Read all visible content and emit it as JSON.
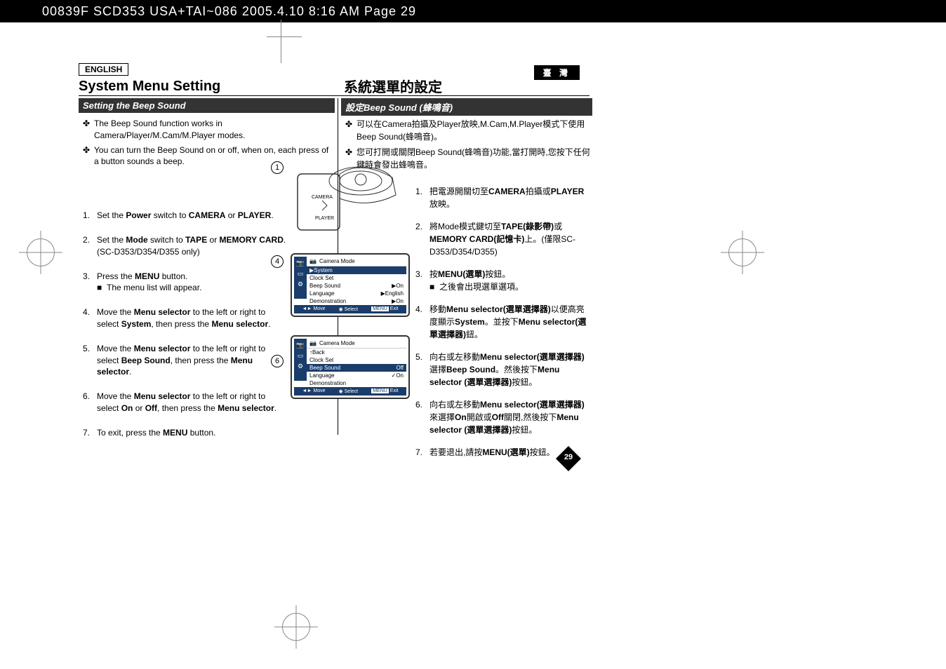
{
  "header": "00839F SCD353 USA+TAI~086  2005.4.10  8:16 AM  Page 29",
  "lang_en": "ENGLISH",
  "lang_tw": "臺 灣",
  "title_en": "System Menu Setting",
  "title_tw": "系統選單的設定",
  "subtitle_en": "Setting the Beep Sound",
  "subtitle_tw": "設定Beep Sound (蜂鳴音)",
  "en_bullets": [
    "The Beep Sound function works in Camera/Player/M.Cam/M.Player modes.",
    "You can turn the Beep Sound on or off, when on, each press of a button sounds a beep."
  ],
  "tw_bullets": [
    "可以在Camera拍攝及Player放映,M.Cam,M.Player模式下使用 Beep Sound(蜂鳴音)。",
    "您可打開或關閉Beep Sound(蜂鳴音)功能,當打開時,您按下任何鍵時會發出蜂鳴音。"
  ],
  "en_steps": [
    {
      "n": "1.",
      "t": "Set the <b>Power</b> switch to <b>CAMERA</b> or <b>PLAYER</b>."
    },
    {
      "n": "2.",
      "t": "Set the <b>Mode</b> switch to <b>TAPE</b> or <b>MEMORY CARD</b>. (SC-D353/D354/D355 only)"
    },
    {
      "n": "3.",
      "t": "Press the <b>MENU</b> button.<div class='sub-bullet'><span class='sq'>■</span><span>The menu list will appear.</span></div>"
    },
    {
      "n": "4.",
      "t": "Move the <b>Menu selector</b> to the left or right to select <b>System</b>, then press the <b>Menu selector</b>."
    },
    {
      "n": "5.",
      "t": "Move the <b>Menu selector</b> to the left or right to select <b>Beep Sound</b>, then press the <b>Menu selector</b>."
    },
    {
      "n": "6.",
      "t": "Move the <b>Menu selector</b> to the left or right to select <b>On</b> or <b>Off</b>, then press the <b>Menu selector</b>."
    },
    {
      "n": "7.",
      "t": "To exit, press the <b>MENU</b> button."
    }
  ],
  "tw_steps": [
    {
      "n": "1.",
      "t": "把電源開關切至<b>CAMERA</b>拍攝或<b>PLAYER</b>放映。"
    },
    {
      "n": "2.",
      "t": "將Mode模式鍵切至<b>TAPE(錄影帶)</b>或<b>MEMORY CARD(記憶卡)</b>上。(僅限SC-D353/D354/D355)"
    },
    {
      "n": "3.",
      "t": "按<b>MENU(選單)</b>按鈕。<div class='sub-bullet'><span class='sq'>■</span><span>之後會出現選單選項。</span></div>"
    },
    {
      "n": "4.",
      "t": "移動<b>Menu selector(選單選擇器)</b>以便高亮度顯示<b>System</b>。並按下<b>Menu selector(選單選擇器)</b>鈕。"
    },
    {
      "n": "5.",
      "t": "向右或左移動<b>Menu selector(選單選擇器)</b>選擇<b>Beep Sound</b>。然後按下<b>Menu selector (選單選擇器)</b>按鈕。"
    },
    {
      "n": "6.",
      "t": "向右或左移動<b>Menu selector(選單選擇器)</b>來選擇<b>On</b>開啟或<b>Off</b>關閉,然後按下<b>Menu selector (選單選擇器)</b>按鈕。"
    },
    {
      "n": "7.",
      "t": "若要退出,請按<b>MENU(選單)</b>按鈕。"
    }
  ],
  "camera_label": "CAMERA",
  "player_label": "PLAYER",
  "menu1": {
    "title": "Camera Mode",
    "hl": "▶System",
    "rows": [
      {
        "l": "Clock Set",
        "v": ""
      },
      {
        "l": "Beep Sound",
        "v": "▶On"
      },
      {
        "l": "Language",
        "v": "▶English"
      },
      {
        "l": "Demonstration",
        "v": "▶On"
      }
    ],
    "footer": [
      "Move",
      "Select",
      "Exit"
    ]
  },
  "menu2": {
    "title": "Camera Mode",
    "back": "Back",
    "rows": [
      {
        "l": "Clock Set",
        "v": ""
      },
      {
        "l": "Beep Sound",
        "v": "Off",
        "hl": true
      },
      {
        "l": "Language",
        "v": "✓On"
      },
      {
        "l": "Demonstration",
        "v": ""
      }
    ],
    "footer": [
      "Move",
      "Select",
      "Exit"
    ]
  },
  "page_num": "29",
  "circle1": "1",
  "circle4": "4",
  "circle6": "6",
  "footer_icons": {
    "move": "◄►",
    "select": "◉",
    "menu": "MENU"
  }
}
